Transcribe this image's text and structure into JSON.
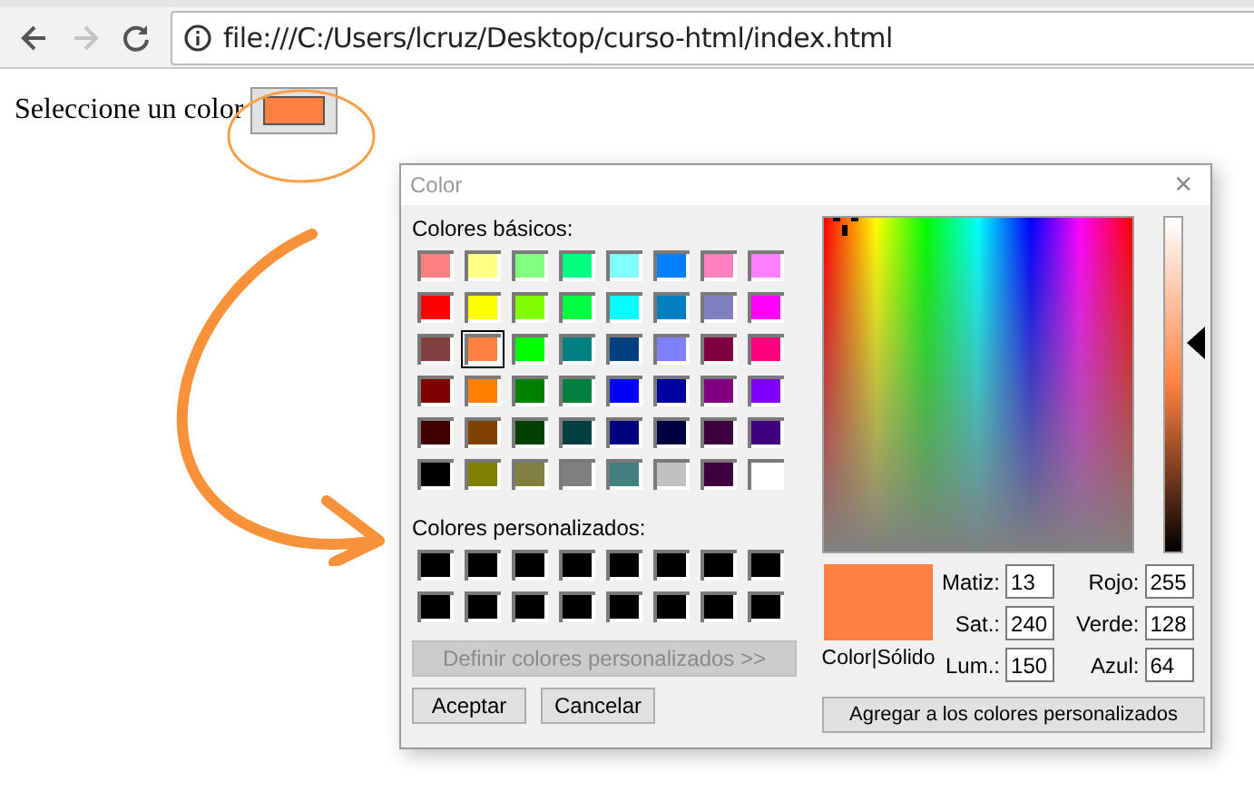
{
  "browser": {
    "nav": [
      {
        "kind": "back",
        "disabled": false
      },
      {
        "kind": "forward",
        "disabled": true
      },
      {
        "kind": "reload",
        "disabled": false
      }
    ],
    "address": "file:///C:/Users/lcruz/Desktop/curso-html/index.html"
  },
  "page": {
    "label": "Seleccione un color",
    "color_button": {
      "color": "#ff8040"
    }
  },
  "dialog": {
    "title": "Color",
    "close": "×",
    "basic_label": "Colores básicos:",
    "basic_colors": [
      {
        "color": "#ff8080",
        "selected": false
      },
      {
        "color": "#ffff80",
        "selected": false
      },
      {
        "color": "#80ff80",
        "selected": false
      },
      {
        "color": "#00ff80",
        "selected": false
      },
      {
        "color": "#80ffff",
        "selected": false
      },
      {
        "color": "#0080ff",
        "selected": false
      },
      {
        "color": "#ff80c0",
        "selected": false
      },
      {
        "color": "#ff80ff",
        "selected": false
      },
      {
        "color": "#ff0000",
        "selected": false
      },
      {
        "color": "#ffff00",
        "selected": false
      },
      {
        "color": "#80ff00",
        "selected": false
      },
      {
        "color": "#00ff40",
        "selected": false
      },
      {
        "color": "#00ffff",
        "selected": false
      },
      {
        "color": "#0080c0",
        "selected": false
      },
      {
        "color": "#8080c0",
        "selected": false
      },
      {
        "color": "#ff00ff",
        "selected": false
      },
      {
        "color": "#804040",
        "selected": false
      },
      {
        "color": "#ff8040",
        "selected": true
      },
      {
        "color": "#00ff00",
        "selected": false
      },
      {
        "color": "#008080",
        "selected": false
      },
      {
        "color": "#004080",
        "selected": false
      },
      {
        "color": "#8080ff",
        "selected": false
      },
      {
        "color": "#800040",
        "selected": false
      },
      {
        "color": "#ff0080",
        "selected": false
      },
      {
        "color": "#800000",
        "selected": false
      },
      {
        "color": "#ff8000",
        "selected": false
      },
      {
        "color": "#008000",
        "selected": false
      },
      {
        "color": "#008040",
        "selected": false
      },
      {
        "color": "#0000ff",
        "selected": false
      },
      {
        "color": "#0000a0",
        "selected": false
      },
      {
        "color": "#800080",
        "selected": false
      },
      {
        "color": "#8000ff",
        "selected": false
      },
      {
        "color": "#400000",
        "selected": false
      },
      {
        "color": "#804000",
        "selected": false
      },
      {
        "color": "#004000",
        "selected": false
      },
      {
        "color": "#004040",
        "selected": false
      },
      {
        "color": "#000080",
        "selected": false
      },
      {
        "color": "#000040",
        "selected": false
      },
      {
        "color": "#400040",
        "selected": false
      },
      {
        "color": "#400080",
        "selected": false
      },
      {
        "color": "#000000",
        "selected": false
      },
      {
        "color": "#808000",
        "selected": false
      },
      {
        "color": "#808040",
        "selected": false
      },
      {
        "color": "#808080",
        "selected": false
      },
      {
        "color": "#408080",
        "selected": false
      },
      {
        "color": "#c0c0c0",
        "selected": false
      },
      {
        "color": "#400040",
        "selected": false
      },
      {
        "color": "#ffffff",
        "selected": false
      }
    ],
    "custom_label": "Colores personalizados:",
    "custom_colors": [
      {
        "color": "#000000"
      },
      {
        "color": "#000000"
      },
      {
        "color": "#000000"
      },
      {
        "color": "#000000"
      },
      {
        "color": "#000000"
      },
      {
        "color": "#000000"
      },
      {
        "color": "#000000"
      },
      {
        "color": "#000000"
      },
      {
        "color": "#000000"
      },
      {
        "color": "#000000"
      },
      {
        "color": "#000000"
      },
      {
        "color": "#000000"
      },
      {
        "color": "#000000"
      },
      {
        "color": "#000000"
      },
      {
        "color": "#000000"
      },
      {
        "color": "#000000"
      }
    ],
    "define_button": {
      "label": "Definir colores personalizados >>",
      "disabled": true
    },
    "buttons": [
      "Aceptar",
      "Cancelar"
    ],
    "luminance_slider": {
      "level": 0.625
    },
    "preview": {
      "color": "#ff8040",
      "caption": "Color|Sólido"
    },
    "fields_left": [
      {
        "label": "Matiz:",
        "value": "13"
      },
      {
        "label": "Sat.:",
        "value": "240"
      },
      {
        "label": "Lum.:",
        "value": "150"
      }
    ],
    "fields_right": [
      {
        "label": "Rojo:",
        "value": "255"
      },
      {
        "label": "Verde:",
        "value": "128"
      },
      {
        "label": "Azul:",
        "value": "64"
      }
    ],
    "add_button": "Agregar a los colores personalizados"
  }
}
